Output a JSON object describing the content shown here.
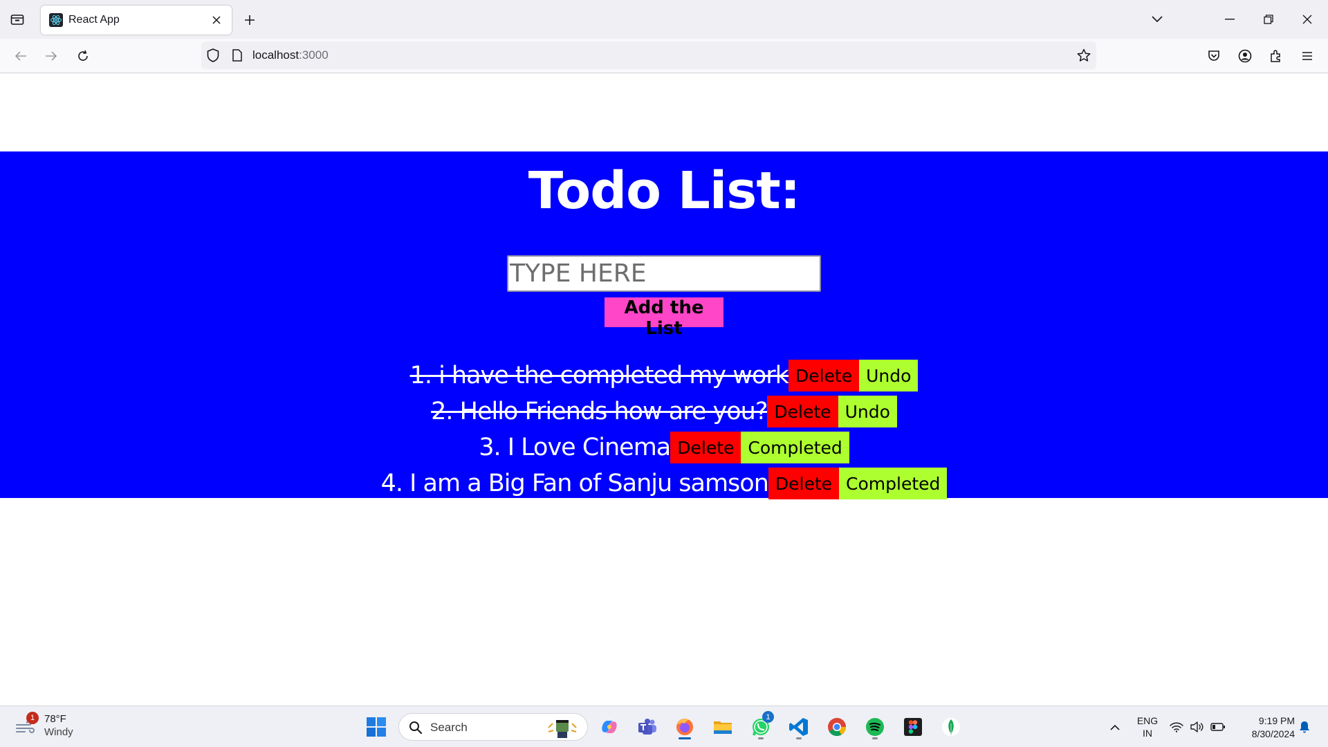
{
  "browser": {
    "tab_title": "React App",
    "url_host": "localhost",
    "url_port": ":3000"
  },
  "app": {
    "title": "Todo List:",
    "input_placeholder": "TYPE HERE",
    "add_button": "Add the List",
    "todos": [
      {
        "text": "1. i have the completed my work",
        "completed": true,
        "delete_label": "Delete",
        "action_label": "Undo"
      },
      {
        "text": "2. Hello Friends how are you?",
        "completed": true,
        "delete_label": "Delete",
        "action_label": "Undo"
      },
      {
        "text": "3. I Love Cinema",
        "completed": false,
        "delete_label": "Delete",
        "action_label": "Completed"
      },
      {
        "text": "4. I am a Big Fan of Sanju samson",
        "completed": false,
        "delete_label": "Delete",
        "action_label": "Completed"
      }
    ],
    "colors": {
      "background": "#0000ff",
      "add_button": "#ff45c8",
      "delete_button": "#ff0000",
      "action_button": "#adff2f"
    }
  },
  "taskbar": {
    "weather": {
      "temp": "78°F",
      "condition": "Windy",
      "badge": "1"
    },
    "search_label": "Search",
    "whatsapp_badge": "1",
    "language": {
      "line1": "ENG",
      "line2": "IN"
    },
    "clock": {
      "time": "9:19 PM",
      "date": "8/30/2024"
    }
  }
}
